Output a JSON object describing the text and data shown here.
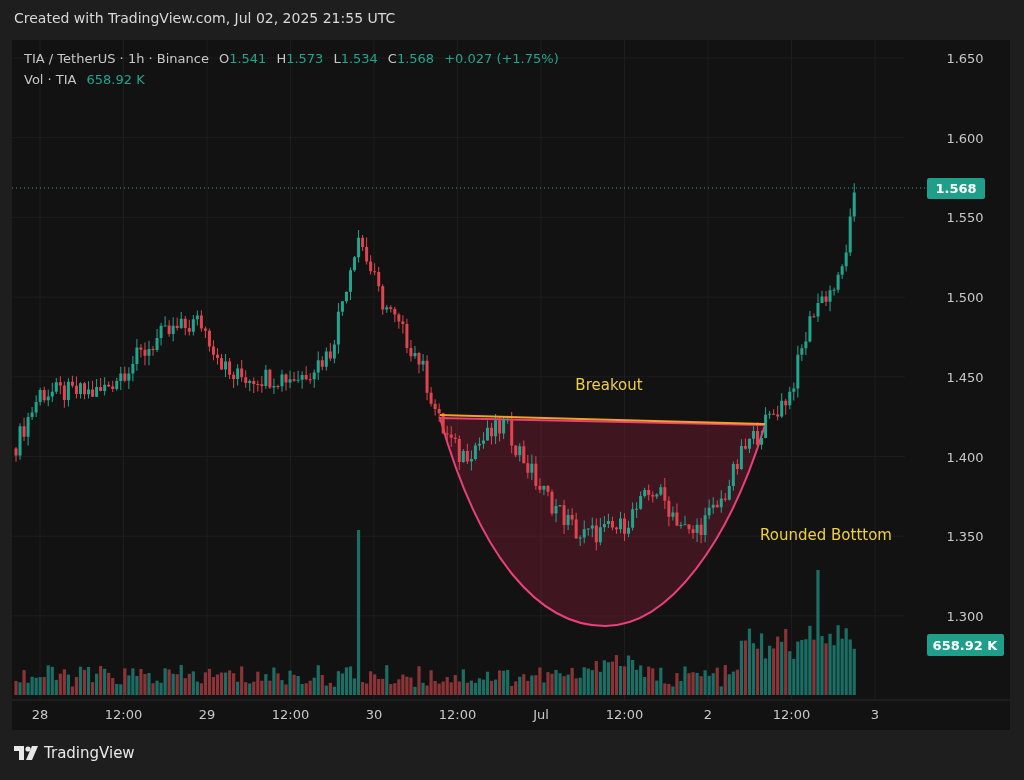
{
  "header": {
    "caption": "Created with TradingView.com, Jul 02, 2025 21:55 UTC"
  },
  "legend": {
    "symbol": "TIA / TetherUS · 1h · Binance",
    "ohlc": [
      {
        "label": "O",
        "value": "1.541"
      },
      {
        "label": "H",
        "value": "1.573"
      },
      {
        "label": "L",
        "value": "1.534"
      },
      {
        "label": "C",
        "value": "1.568"
      }
    ],
    "change": "+0.027 (+1.75%)",
    "volume_label": "Vol · TIA",
    "volume_value": "658.92 K"
  },
  "price_axis": {
    "ticks": [
      "1.650",
      "1.600",
      "1.550",
      "1.500",
      "1.450",
      "1.400",
      "1.350",
      "1.300"
    ],
    "last_price": "1.568",
    "last_volume": "658.92 K"
  },
  "time_axis": {
    "ticks": [
      "28",
      "12:00",
      "29",
      "12:00",
      "30",
      "12:00",
      "Jul",
      "12:00",
      "2",
      "12:00",
      "3"
    ]
  },
  "annotations": [
    "Breakout",
    "Rounded Botttom"
  ],
  "footer": {
    "brand": "TradingView"
  }
}
